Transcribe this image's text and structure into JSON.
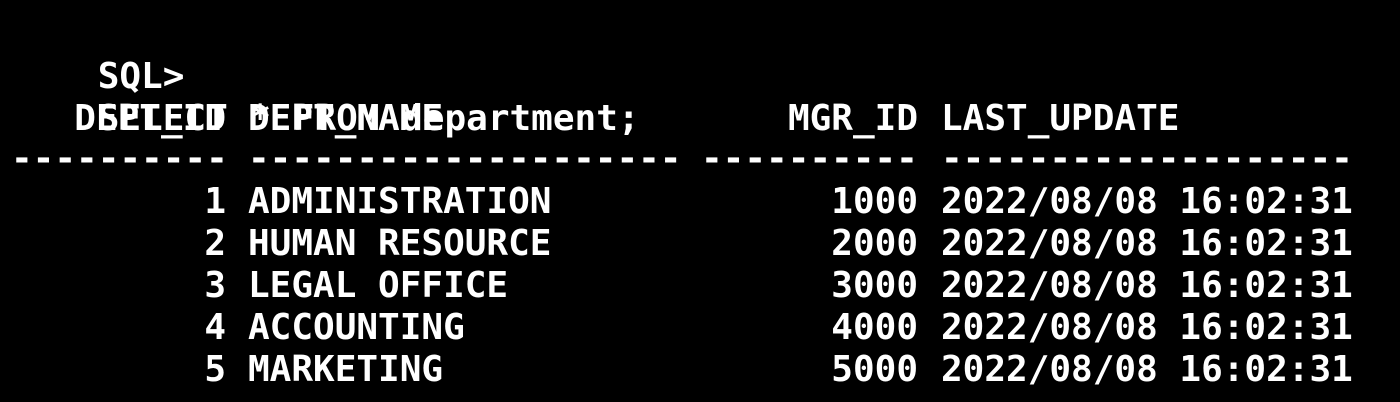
{
  "prompt": "SQL>",
  "command": "SELECT * FROM department;",
  "columns": [
    "DEPT_ID",
    "DEPT_NAME",
    "MGR_ID",
    "LAST_UPDATE"
  ],
  "separators": [
    "----------",
    "--------------------",
    "----------",
    "-------------------"
  ],
  "rows": [
    [
      "1",
      "ADMINISTRATION",
      "1000",
      "2022/08/08 16:02:31"
    ],
    [
      "2",
      "HUMAN RESOURCE",
      "2000",
      "2022/08/08 16:02:31"
    ],
    [
      "3",
      "LEGAL OFFICE",
      "3000",
      "2022/08/08 16:02:31"
    ],
    [
      "4",
      "ACCOUNTING",
      "4000",
      "2022/08/08 16:02:31"
    ],
    [
      "5",
      "MARKETING",
      "5000",
      "2022/08/08 16:02:31"
    ]
  ],
  "colors": {
    "background": "#000000",
    "foreground": "#ffffff"
  }
}
